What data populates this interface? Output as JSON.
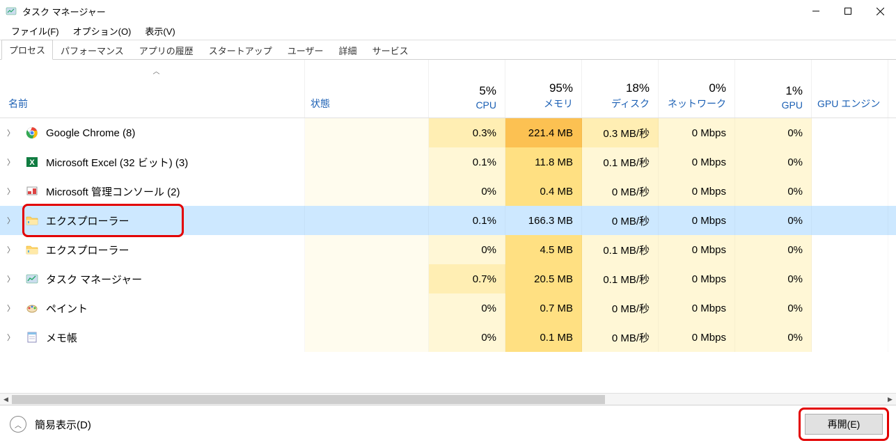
{
  "titlebar": {
    "title": "タスク マネージャー"
  },
  "menu": {
    "file": "ファイル(F)",
    "options": "オプション(O)",
    "view": "表示(V)"
  },
  "tabs": [
    "プロセス",
    "パフォーマンス",
    "アプリの履歴",
    "スタートアップ",
    "ユーザー",
    "詳細",
    "サービス"
  ],
  "columns": {
    "name": "名前",
    "status": "状態",
    "cpu": {
      "pct": "5%",
      "label": "CPU"
    },
    "memory": {
      "pct": "95%",
      "label": "メモリ"
    },
    "disk": {
      "pct": "18%",
      "label": "ディスク"
    },
    "network": {
      "pct": "0%",
      "label": "ネットワーク"
    },
    "gpu": {
      "pct": "1%",
      "label": "GPU"
    },
    "gpu_engine": "GPU エンジン"
  },
  "rows": [
    {
      "name": "Google Chrome (8)",
      "cpu": "0.3%",
      "mem": "221.4 MB",
      "disk": "0.3 MB/秒",
      "net": "0 Mbps",
      "gpu": "0%",
      "icon": "chrome"
    },
    {
      "name": "Microsoft Excel (32 ビット) (3)",
      "cpu": "0.1%",
      "mem": "11.8 MB",
      "disk": "0.1 MB/秒",
      "net": "0 Mbps",
      "gpu": "0%",
      "icon": "excel"
    },
    {
      "name": "Microsoft 管理コンソール (2)",
      "cpu": "0%",
      "mem": "0.4 MB",
      "disk": "0 MB/秒",
      "net": "0 Mbps",
      "gpu": "0%",
      "icon": "mmc"
    },
    {
      "name": "エクスプローラー",
      "cpu": "0.1%",
      "mem": "166.3 MB",
      "disk": "0 MB/秒",
      "net": "0 Mbps",
      "gpu": "0%",
      "icon": "explorer",
      "selected": true
    },
    {
      "name": "エクスプローラー",
      "cpu": "0%",
      "mem": "4.5 MB",
      "disk": "0.1 MB/秒",
      "net": "0 Mbps",
      "gpu": "0%",
      "icon": "explorer"
    },
    {
      "name": "タスク マネージャー",
      "cpu": "0.7%",
      "mem": "20.5 MB",
      "disk": "0.1 MB/秒",
      "net": "0 Mbps",
      "gpu": "0%",
      "icon": "taskmgr"
    },
    {
      "name": "ペイント",
      "cpu": "0%",
      "mem": "0.7 MB",
      "disk": "0 MB/秒",
      "net": "0 Mbps",
      "gpu": "0%",
      "icon": "paint"
    },
    {
      "name": "メモ帳",
      "cpu": "0%",
      "mem": "0.1 MB",
      "disk": "0 MB/秒",
      "net": "0 Mbps",
      "gpu": "0%",
      "icon": "notepad"
    }
  ],
  "heat": {
    "cpu": [
      "med",
      "low",
      "low",
      "sel",
      "low",
      "med",
      "low",
      "low"
    ],
    "mem": [
      "veryhigh",
      "high",
      "high",
      "sel",
      "high",
      "high",
      "high",
      "high"
    ],
    "disk": [
      "med",
      "low",
      "low",
      "sel",
      "low",
      "low",
      "low",
      "low"
    ],
    "net": [
      "low",
      "low",
      "low",
      "sel",
      "low",
      "low",
      "low",
      "low"
    ],
    "gpu": [
      "low",
      "low",
      "low",
      "sel",
      "low",
      "low",
      "low",
      "low"
    ]
  },
  "footer": {
    "fewer_details": "簡易表示(D)",
    "restart": "再開(E)"
  }
}
